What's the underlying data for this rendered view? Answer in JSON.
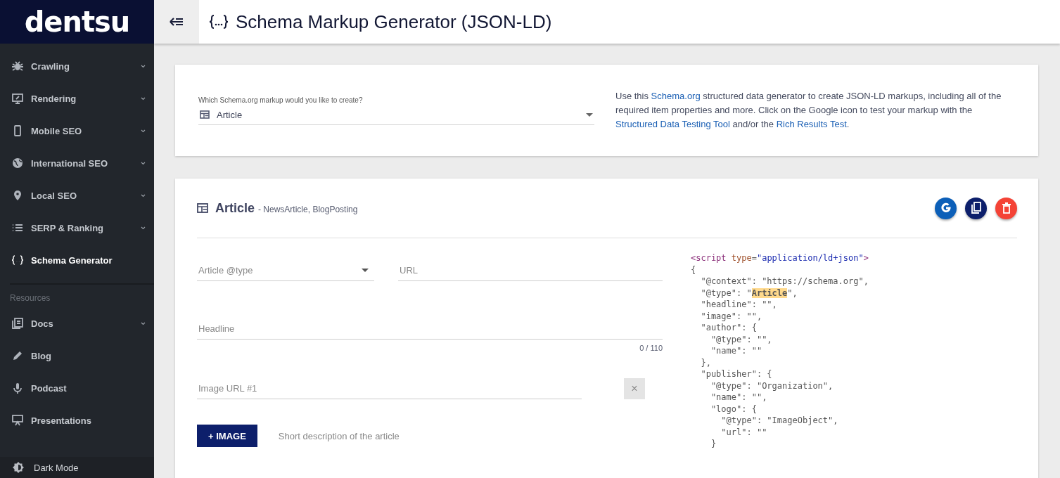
{
  "brand": {
    "logo": "dentsu"
  },
  "header": {
    "title": "Schema Markup Generator (JSON-LD)"
  },
  "sidebar": {
    "items": [
      {
        "kind": "bug",
        "label": "Crawling",
        "expandable": true,
        "selected": false
      },
      {
        "kind": "monitor",
        "label": "Rendering",
        "expandable": true,
        "selected": false
      },
      {
        "kind": "phone",
        "label": "Mobile SEO",
        "expandable": true,
        "selected": false
      },
      {
        "kind": "globe",
        "label": "International SEO",
        "expandable": true,
        "selected": false
      },
      {
        "kind": "pin",
        "label": "Local SEO",
        "expandable": true,
        "selected": false
      },
      {
        "kind": "list",
        "label": "SERP & Ranking",
        "expandable": true,
        "selected": false
      },
      {
        "kind": "braces",
        "label": "Schema Generator",
        "expandable": false,
        "selected": true
      }
    ],
    "section_label": "Resources",
    "resources": [
      {
        "kind": "docs",
        "label": "Docs",
        "expandable": true,
        "selected": false
      },
      {
        "kind": "pencil",
        "label": "Blog",
        "expandable": false,
        "selected": false
      },
      {
        "kind": "mic",
        "label": "Podcast",
        "expandable": false,
        "selected": false
      },
      {
        "kind": "easel",
        "label": "Presentations",
        "expandable": false,
        "selected": false
      }
    ],
    "dark_mode": {
      "label": "Dark Mode"
    }
  },
  "picker": {
    "label": "Which Schema.org markup would you like to create?",
    "value": "Article"
  },
  "intro": [
    {
      "kind": "text",
      "text": "Use this "
    },
    {
      "kind": "link",
      "text": "Schema.org"
    },
    {
      "kind": "text",
      "text": " structured data generator to create JSON-LD markups, including all of the required item properties and more. Click on the Google icon to test your markup with the "
    },
    {
      "kind": "link",
      "text": "Structured Data Testing Tool"
    },
    {
      "kind": "text",
      "text": " and/or the "
    },
    {
      "kind": "link",
      "text": "Rich Results Test"
    },
    {
      "kind": "text",
      "text": "."
    }
  ],
  "editor": {
    "title": "Article",
    "subtitle": "- NewsArticle, BlogPosting",
    "fields": [
      {
        "kind": "select",
        "placeholder": "Article @type"
      },
      {
        "kind": "text",
        "placeholder": "URL"
      },
      {
        "kind": "counter",
        "placeholder": "Headline",
        "counter": "0 / 110"
      },
      {
        "kind": "removable",
        "placeholder": "Image URL #1",
        "remove": "×"
      }
    ],
    "add_button": "+ IMAGE",
    "description_placeholder": "Short description of the article",
    "code": [
      [
        {
          "kind": "tag",
          "text": "<script "
        },
        {
          "kind": "attr",
          "text": "type"
        },
        {
          "kind": "plain",
          "text": "="
        },
        {
          "kind": "value",
          "text": "\"application/ld+json\""
        },
        {
          "kind": "tag",
          "text": ">"
        }
      ],
      [
        {
          "kind": "plain",
          "text": "{"
        }
      ],
      [
        {
          "kind": "plain",
          "text": "  \"@context\": \"https://schema.org\","
        }
      ],
      [
        {
          "kind": "plain",
          "text": "  \"@type\": \""
        },
        {
          "kind": "highlight",
          "text": "Article"
        },
        {
          "kind": "plain",
          "text": "\","
        }
      ],
      [
        {
          "kind": "plain",
          "text": "  \"headline\": \"\","
        }
      ],
      [
        {
          "kind": "plain",
          "text": "  \"image\": \"\","
        }
      ],
      [
        {
          "kind": "plain",
          "text": "  \"author\": {"
        }
      ],
      [
        {
          "kind": "plain",
          "text": "    \"@type\": \"\","
        }
      ],
      [
        {
          "kind": "plain",
          "text": "    \"name\": \"\""
        }
      ],
      [
        {
          "kind": "plain",
          "text": "  },"
        }
      ],
      [
        {
          "kind": "plain",
          "text": "  \"publisher\": {"
        }
      ],
      [
        {
          "kind": "plain",
          "text": "    \"@type\": \"Organization\","
        }
      ],
      [
        {
          "kind": "plain",
          "text": "    \"name\": \"\","
        }
      ],
      [
        {
          "kind": "plain",
          "text": "    \"logo\": {"
        }
      ],
      [
        {
          "kind": "plain",
          "text": "      \"@type\": \"ImageObject\","
        }
      ],
      [
        {
          "kind": "plain",
          "text": "      \"url\": \"\""
        }
      ],
      [
        {
          "kind": "plain",
          "text": "    }"
        }
      ]
    ]
  }
}
